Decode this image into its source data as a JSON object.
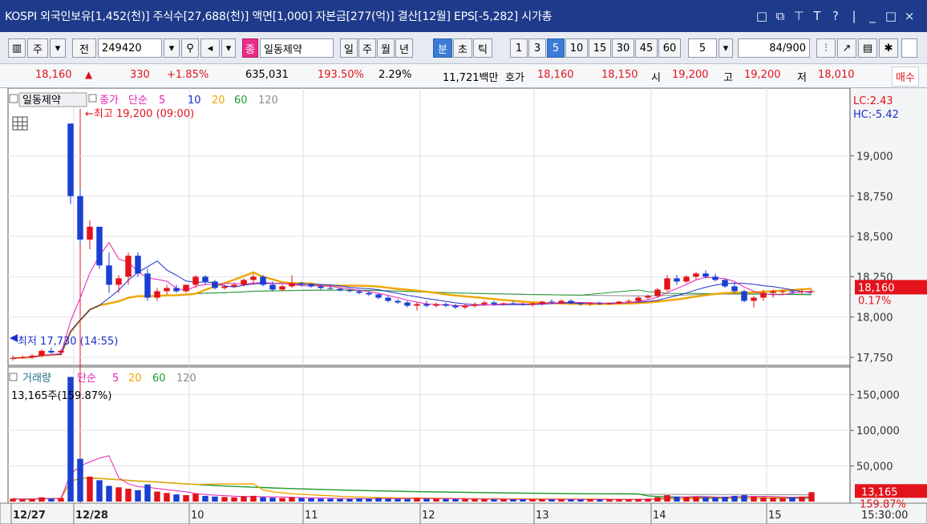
{
  "titlebar": {
    "text": "KOSPI 외국인보유[1,452(천)] 주식수[27,688(천)] 액면[1,000] 자본금[277(억)] 결산[12월] EPS[-5,282] 시가총",
    "icons": [
      "restore-icon",
      "new-window-icon",
      "pin-icon",
      "font-icon",
      "help-icon",
      "minimize-icon",
      "maximize-icon",
      "close-icon"
    ],
    "glyphs": [
      "□",
      "⧉",
      "⊤",
      "T",
      "?",
      "|",
      "_",
      "□",
      "×"
    ]
  },
  "toolbar": {
    "tab_ju": "주",
    "tab_jeon": "전",
    "code": "249420",
    "name_badge": "종",
    "stock_name": "일동제약",
    "periods": [
      "일",
      "주",
      "월",
      "년",
      "분",
      "초",
      "틱"
    ],
    "selected_period": "분",
    "minutes": [
      "1",
      "3",
      "5",
      "10",
      "15",
      "30",
      "45",
      "60"
    ],
    "selected_minute": "5",
    "interval_value": "5",
    "count_value": "84",
    "count_total": "/900"
  },
  "quote": {
    "price": "18,160",
    "change": "330",
    "change_pct": "+1.85%",
    "volume": "635,031",
    "volume_ratio": "193.50%",
    "turnover": "2.29%",
    "amount": "11,721백만",
    "hoga_label": "호가",
    "ask": "18,160",
    "bid": "18,150",
    "open_label": "시",
    "open": "19,200",
    "high_label": "고",
    "high": "19,200",
    "low_label": "저",
    "low": "18,010",
    "trade_button": "매수"
  },
  "price_pane": {
    "legend_name": "일동제약",
    "legend_close": "종가",
    "legend_ma_type": "단순",
    "ma": [
      "5",
      "10",
      "20",
      "60",
      "120"
    ],
    "high_note": "←최고 19,200 (09:00)",
    "low_note": "최저 17,730 (14:55)",
    "lc": "LC:2.43",
    "hc": "HC:-5.42",
    "current_tag": "18,160",
    "current_pct": "0.17%"
  },
  "volume_pane": {
    "legend_name": "거래량",
    "legend_ma_type": "단순",
    "ma": [
      "5",
      "20",
      "60",
      "120"
    ],
    "current_value": "13,165주(159.87%)",
    "current_tag": "13,165",
    "current_pct": "159.87%"
  },
  "x_axis": {
    "labels": [
      "12/27",
      "12/28",
      "10",
      "11",
      "12",
      "13",
      "14",
      "15"
    ],
    "time": "15:30:00"
  },
  "colors": {
    "up": "#e3131b",
    "down": "#1a3fd2",
    "ma5": "#e61fb4",
    "ma10": "#1a2fc9",
    "ma20": "#f0a500",
    "ma60": "#1d9c2f",
    "ma120": "#8a8a8a",
    "titlebar": "#1e3a8a"
  },
  "chart_data": [
    {
      "type": "candlestick",
      "series": "일동제약 5분봉",
      "ylim": [
        17700,
        19400
      ],
      "yticks": [
        17750,
        18000,
        18250,
        18500,
        18750,
        19000
      ],
      "candles": [
        [
          17740,
          17760,
          17730,
          17745
        ],
        [
          17745,
          17760,
          17740,
          17750
        ],
        [
          17750,
          17770,
          17740,
          17760
        ],
        [
          17760,
          17800,
          17750,
          17790
        ],
        [
          17790,
          17810,
          17770,
          17780
        ],
        [
          17780,
          17800,
          17760,
          17790
        ],
        [
          19200,
          19200,
          18700,
          18750
        ],
        [
          18750,
          18800,
          18450,
          18480
        ],
        [
          18480,
          18600,
          18420,
          18560
        ],
        [
          18560,
          18560,
          18300,
          18320
        ],
        [
          18320,
          18400,
          18150,
          18200
        ],
        [
          18200,
          18260,
          18150,
          18240
        ],
        [
          18250,
          18400,
          18200,
          18380
        ],
        [
          18380,
          18400,
          18250,
          18270
        ],
        [
          18270,
          18300,
          18100,
          18120
        ],
        [
          18120,
          18180,
          18100,
          18160
        ],
        [
          18160,
          18200,
          18140,
          18180
        ],
        [
          18180,
          18200,
          18150,
          18160
        ],
        [
          18160,
          18200,
          18150,
          18200
        ],
        [
          18200,
          18260,
          18180,
          18250
        ],
        [
          18250,
          18260,
          18200,
          18220
        ],
        [
          18220,
          18230,
          18170,
          18180
        ],
        [
          18180,
          18200,
          18170,
          18190
        ],
        [
          18190,
          18210,
          18180,
          18200
        ],
        [
          18200,
          18240,
          18190,
          18230
        ],
        [
          18230,
          18270,
          18200,
          18250
        ],
        [
          18250,
          18260,
          18190,
          18200
        ],
        [
          18200,
          18220,
          18160,
          18170
        ],
        [
          18170,
          18200,
          18160,
          18190
        ],
        [
          18190,
          18260,
          18180,
          18210
        ],
        [
          18210,
          18220,
          18190,
          18200
        ],
        [
          18200,
          18210,
          18180,
          18190
        ],
        [
          18190,
          18200,
          18170,
          18180
        ],
        [
          18180,
          18190,
          18170,
          18175
        ],
        [
          18175,
          18180,
          18160,
          18165
        ],
        [
          18165,
          18175,
          18155,
          18160
        ],
        [
          18160,
          18170,
          18140,
          18150
        ],
        [
          18150,
          18160,
          18130,
          18140
        ],
        [
          18140,
          18150,
          18110,
          18120
        ],
        [
          18120,
          18130,
          18090,
          18100
        ],
        [
          18100,
          18110,
          18080,
          18090
        ],
        [
          18090,
          18100,
          18060,
          18070
        ],
        [
          18070,
          18090,
          18040,
          18080
        ],
        [
          18080,
          18100,
          18060,
          18070
        ],
        [
          18070,
          18090,
          18060,
          18080
        ],
        [
          18080,
          18090,
          18060,
          18070
        ],
        [
          18070,
          18080,
          18050,
          18060
        ],
        [
          18060,
          18080,
          18050,
          18070
        ],
        [
          18070,
          18090,
          18060,
          18080
        ],
        [
          18080,
          18100,
          18070,
          18090
        ],
        [
          18090,
          18100,
          18070,
          18080
        ],
        [
          18080,
          18090,
          18070,
          18085
        ],
        [
          18085,
          18100,
          18075,
          18080
        ],
        [
          18080,
          18090,
          18070,
          18075
        ],
        [
          18075,
          18090,
          18065,
          18085
        ],
        [
          18085,
          18100,
          18070,
          18095
        ],
        [
          18095,
          18110,
          18080,
          18090
        ],
        [
          18090,
          18110,
          18080,
          18100
        ],
        [
          18100,
          18110,
          18080,
          18085
        ],
        [
          18085,
          18090,
          18070,
          18080
        ],
        [
          18080,
          18090,
          18070,
          18085
        ],
        [
          18085,
          18095,
          18075,
          18080
        ],
        [
          18080,
          18090,
          18075,
          18085
        ],
        [
          18085,
          18100,
          18080,
          18095
        ],
        [
          18095,
          18110,
          18085,
          18100
        ],
        [
          18100,
          18130,
          18090,
          18120
        ],
        [
          18120,
          18140,
          18110,
          18130
        ],
        [
          18130,
          18180,
          18120,
          18170
        ],
        [
          18170,
          18260,
          18160,
          18240
        ],
        [
          18240,
          18260,
          18200,
          18220
        ],
        [
          18220,
          18260,
          18210,
          18250
        ],
        [
          18250,
          18280,
          18230,
          18270
        ],
        [
          18270,
          18290,
          18240,
          18250
        ],
        [
          18250,
          18270,
          18220,
          18230
        ],
        [
          18230,
          18240,
          18180,
          18190
        ],
        [
          18190,
          18210,
          18150,
          18160
        ],
        [
          18160,
          18170,
          18090,
          18100
        ],
        [
          18100,
          18130,
          18060,
          18120
        ],
        [
          18120,
          18170,
          18100,
          18150
        ],
        [
          18150,
          18170,
          18120,
          18160
        ],
        [
          18160,
          18170,
          18140,
          18160
        ],
        [
          18160,
          18170,
          18140,
          18155
        ],
        [
          18155,
          18170,
          18140,
          18160
        ],
        [
          18160,
          18170,
          18150,
          18160
        ]
      ],
      "volume_ylim": [
        0,
        180000
      ],
      "volume_yticks": [
        50000,
        100000,
        150000
      ],
      "volume": [
        4000,
        3000,
        3500,
        6000,
        4000,
        5000,
        175000,
        60000,
        35000,
        30000,
        22000,
        20000,
        18000,
        16000,
        24000,
        14000,
        12000,
        10000,
        9000,
        11000,
        8000,
        7000,
        6500,
        6000,
        7500,
        8000,
        6000,
        5500,
        5000,
        6000,
        5000,
        4500,
        4200,
        4000,
        3800,
        3600,
        4500,
        4000,
        5000,
        4200,
        3800,
        3600,
        5000,
        4000,
        3800,
        3600,
        3500,
        3400,
        3300,
        3400,
        3200,
        3100,
        3000,
        3100,
        3300,
        3200,
        3000,
        3100,
        2900,
        2800,
        3000,
        2900,
        2800,
        3100,
        3000,
        3500,
        4000,
        6000,
        9000,
        7000,
        6500,
        7000,
        6000,
        5500,
        6500,
        8000,
        9000,
        7000,
        6000,
        5500,
        5000,
        6000,
        7000,
        13165
      ]
    }
  ]
}
